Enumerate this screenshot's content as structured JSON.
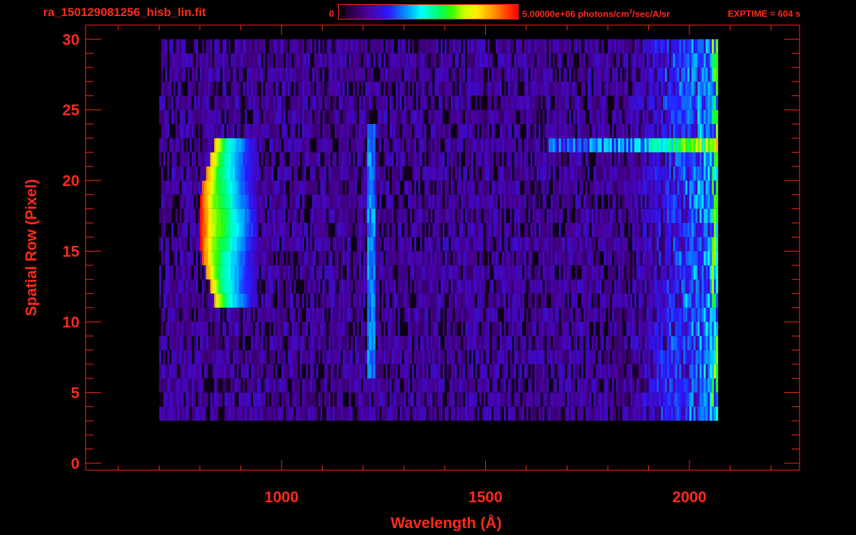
{
  "header": {
    "filename": "ra_150129081256_hisb_lin.fit",
    "colorbar_min": "0",
    "colorbar_max_value": "5.00000e+06 photons/cm",
    "colorbar_max_exp": "2",
    "colorbar_max_unit": "/sec/A/sr",
    "exptime": "EXPTIME = 604 s"
  },
  "colors": {
    "axis": "#ff2a1a",
    "background": "#000000"
  },
  "chart_data": {
    "type": "heatmap",
    "title": "ra_150129081256_hisb_lin.fit",
    "xlabel": "Wavelength (Å)",
    "ylabel": "Spatial Row (Pixel)",
    "xlim": [
      520,
      2270
    ],
    "ylim": [
      -0.5,
      31
    ],
    "xticks": [
      1000,
      1500,
      2000
    ],
    "xtick_labels": [
      "1000",
      "1500",
      "2000"
    ],
    "yticks": [
      0,
      5,
      10,
      15,
      20,
      25,
      30
    ],
    "ytick_labels": [
      "0",
      "5",
      "10",
      "15",
      "20",
      "25",
      "30"
    ],
    "colorbar": {
      "min": 0,
      "max": 5000000,
      "unit": "photons/cm^2/sec/A/sr"
    },
    "grid": false,
    "features": [
      {
        "name": "bright emission blob",
        "x_range": [
          800,
          930
        ],
        "y_range": [
          11,
          23
        ],
        "peak_level": 1.0
      },
      {
        "name": "vertical line",
        "x": 1216,
        "y_range": [
          6,
          24
        ],
        "level": 0.35
      },
      {
        "name": "bright horizontal band",
        "x_range": [
          1650,
          2060
        ],
        "y": 22.5,
        "level": 0.45
      },
      {
        "name": "red-end increase",
        "x_range": [
          1850,
          2070
        ],
        "y_range": [
          3,
          30
        ],
        "level": 0.4
      }
    ],
    "data_extent": {
      "x_range": [
        700,
        2070
      ],
      "y_range": [
        3,
        30
      ]
    }
  }
}
